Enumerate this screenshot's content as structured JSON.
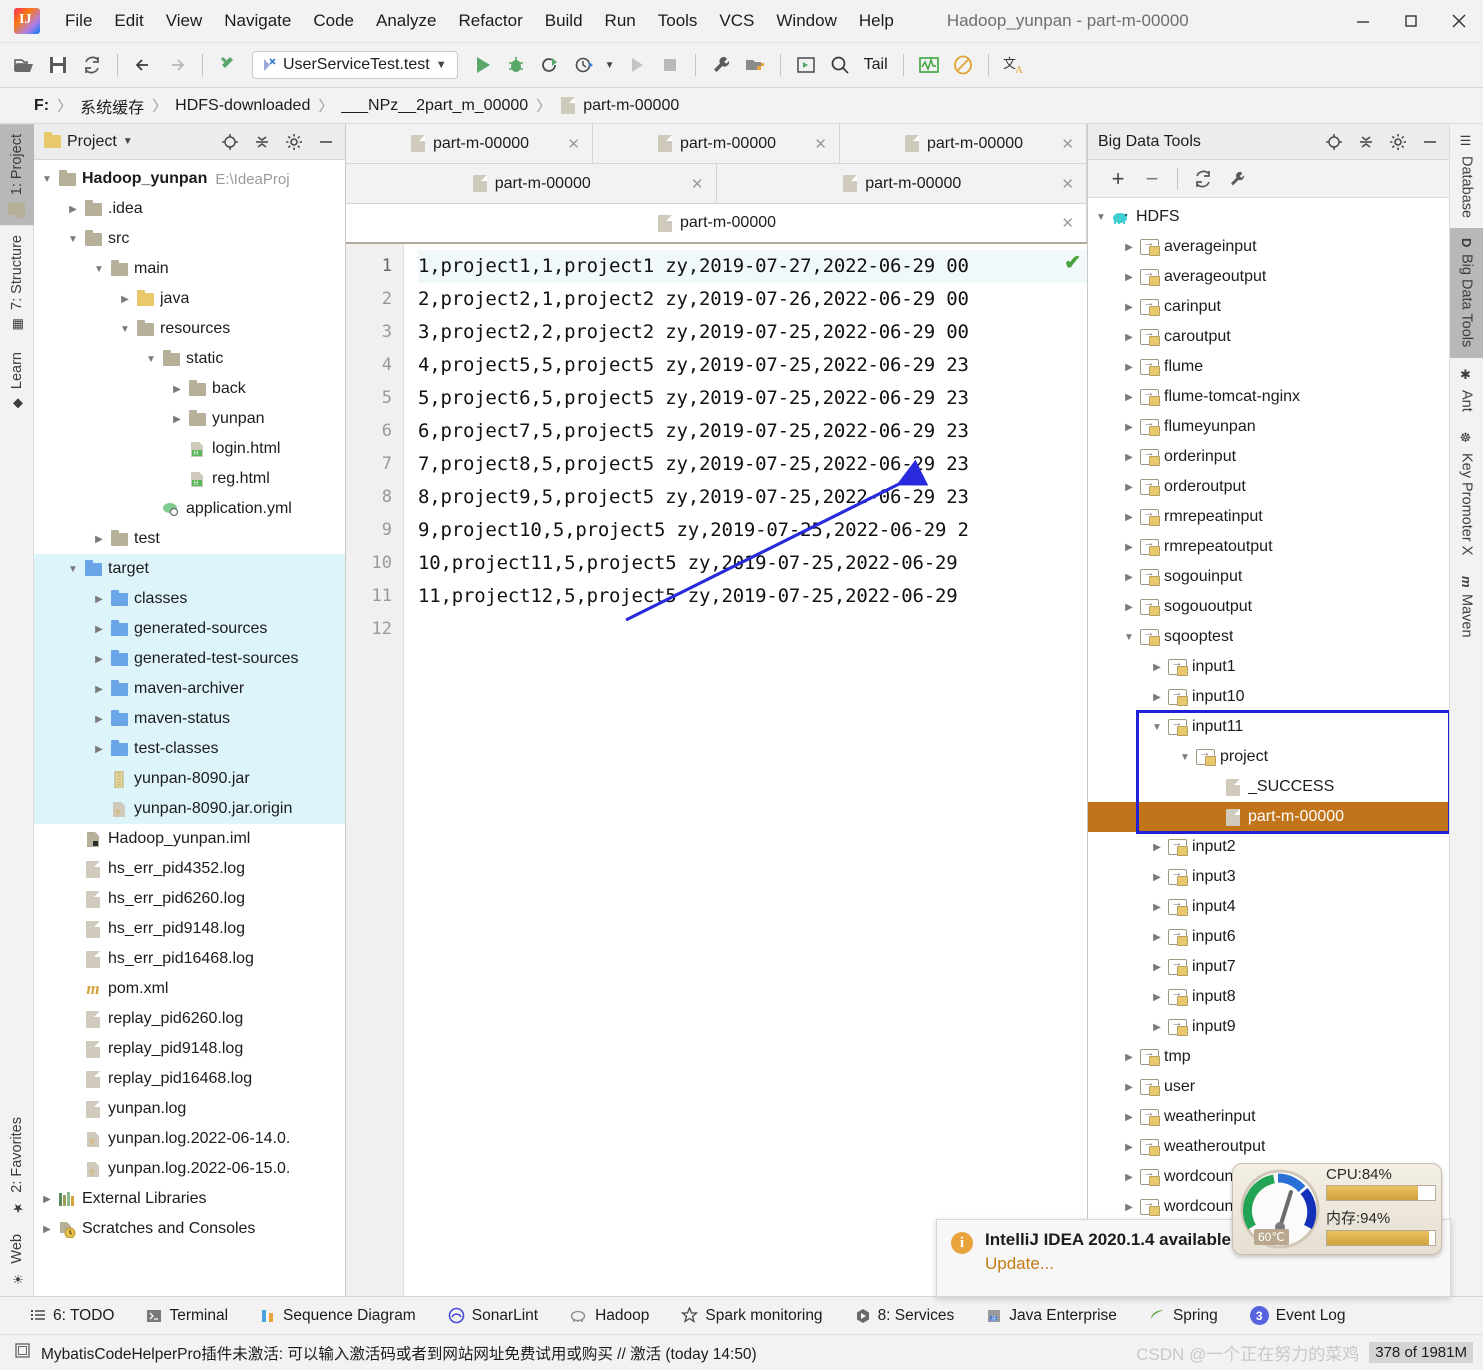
{
  "window": {
    "title": "Hadoop_yunpan - part-m-00000",
    "minimize": "—",
    "maximize": "□",
    "close": "✕"
  },
  "menubar": {
    "items": [
      {
        "label": "File"
      },
      {
        "label": "Edit"
      },
      {
        "label": "View"
      },
      {
        "label": "Navigate"
      },
      {
        "label": "Code"
      },
      {
        "label": "Analyze"
      },
      {
        "label": "Refactor"
      },
      {
        "label": "Build"
      },
      {
        "label": "Run"
      },
      {
        "label": "Tools"
      },
      {
        "label": "VCS"
      },
      {
        "label": "Window"
      },
      {
        "label": "Help"
      }
    ]
  },
  "toolbar": {
    "open_icon": "open-folder-icon",
    "save_icon": "save-icon",
    "sync_icon": "refresh-icon",
    "back_icon": "back-arrow-icon",
    "forward_icon": "forward-arrow-icon",
    "build_icon": "hammer-icon",
    "run_config": "UserServiceTest.test",
    "run_icon": "run-icon",
    "debug_icon": "debug-icon",
    "run_coverage_icon": "run-with-coverage-icon",
    "profile_icon": "profiler-icon",
    "stop_icon": "stop-icon",
    "settings_icon": "wrench-icon",
    "project_structure_icon": "project-structure-icon",
    "terminal_icon": "run-anything-icon",
    "search_icon": "search-everywhere-icon",
    "tail_label": "Tail",
    "monitor_icon": "monitor-icon",
    "no_icon": "suppress-icon",
    "translate_icon": "translate-icon"
  },
  "breadcrumb": {
    "drive": "F:",
    "items": [
      "系统缓存",
      "HDFS-downloaded",
      "___NPz__2part_m_00000",
      "part-m-00000"
    ],
    "separator": "〉"
  },
  "left_stripe": {
    "tabs": [
      {
        "label": "1: Project",
        "icon": "project-folder-icon",
        "active": true
      },
      {
        "label": "7: Structure",
        "icon": "structure-icon",
        "active": false
      },
      {
        "label": "Learn",
        "icon": "learn-icon",
        "active": false
      }
    ],
    "bottom_tabs": [
      {
        "label": "2: Favorites",
        "icon": "star-icon"
      },
      {
        "label": "Web",
        "icon": "web-icon"
      }
    ]
  },
  "right_stripe": {
    "tabs": [
      {
        "label": "Database",
        "icon": "database-icon",
        "active": false
      },
      {
        "label": "Big Data Tools",
        "icon": "big-data-tools-icon",
        "active": true
      },
      {
        "label": "Ant",
        "icon": "ant-icon",
        "active": false
      },
      {
        "label": "Key Promoter X",
        "icon": "key-promoter-icon",
        "active": false
      },
      {
        "label": "Maven",
        "icon": "maven-icon",
        "active": false
      }
    ]
  },
  "project_panel": {
    "title": "Project",
    "dropdown_icon": "chevron-down-icon",
    "locate_icon": "locate-icon",
    "collapse_icon": "collapse-all-icon",
    "settings_icon": "gear-icon",
    "hide_icon": "hide-icon",
    "tree": [
      {
        "label": "Hadoop_yunpan",
        "path": "E:\\IdeaProj",
        "depth": 0,
        "arrow": "down",
        "icon": "module-folder-icon",
        "bold": true,
        "hl": false
      },
      {
        "label": ".idea",
        "depth": 1,
        "arrow": "right",
        "icon": "folder-icon",
        "hl": false
      },
      {
        "label": "src",
        "depth": 1,
        "arrow": "down",
        "icon": "folder-icon",
        "hl": false
      },
      {
        "label": "main",
        "depth": 2,
        "arrow": "down",
        "icon": "folder-icon",
        "hl": false
      },
      {
        "label": "java",
        "depth": 3,
        "arrow": "right",
        "icon": "source-folder-icon",
        "hl": false
      },
      {
        "label": "resources",
        "depth": 3,
        "arrow": "down",
        "icon": "resources-folder-icon",
        "hl": false
      },
      {
        "label": "static",
        "depth": 4,
        "arrow": "down",
        "icon": "folder-icon",
        "hl": false
      },
      {
        "label": "back",
        "depth": 5,
        "arrow": "right",
        "icon": "folder-icon",
        "hl": false
      },
      {
        "label": "yunpan",
        "depth": 5,
        "arrow": "right",
        "icon": "folder-icon",
        "hl": false
      },
      {
        "label": "login.html",
        "depth": 5,
        "arrow": "none",
        "icon": "html-file-icon",
        "hl": false
      },
      {
        "label": "reg.html",
        "depth": 5,
        "arrow": "none",
        "icon": "html-file-icon",
        "hl": false
      },
      {
        "label": "application.yml",
        "depth": 4,
        "arrow": "none",
        "icon": "yml-file-icon",
        "hl": false
      },
      {
        "label": "test",
        "depth": 2,
        "arrow": "right",
        "icon": "folder-icon",
        "hl": false
      },
      {
        "label": "target",
        "depth": 1,
        "arrow": "down",
        "icon": "folder-blue-icon",
        "hl": true
      },
      {
        "label": "classes",
        "depth": 2,
        "arrow": "right",
        "icon": "folder-blue-icon",
        "hl": true
      },
      {
        "label": "generated-sources",
        "depth": 2,
        "arrow": "right",
        "icon": "folder-blue-icon",
        "hl": true
      },
      {
        "label": "generated-test-sources",
        "depth": 2,
        "arrow": "right",
        "icon": "folder-blue-icon",
        "hl": true
      },
      {
        "label": "maven-archiver",
        "depth": 2,
        "arrow": "right",
        "icon": "folder-blue-icon",
        "hl": true
      },
      {
        "label": "maven-status",
        "depth": 2,
        "arrow": "right",
        "icon": "folder-blue-icon",
        "hl": true
      },
      {
        "label": "test-classes",
        "depth": 2,
        "arrow": "right",
        "icon": "folder-blue-icon",
        "hl": true
      },
      {
        "label": "yunpan-8090.jar",
        "depth": 2,
        "arrow": "none",
        "icon": "jar-file-icon",
        "hl": true
      },
      {
        "label": "yunpan-8090.jar.origin",
        "depth": 2,
        "arrow": "none",
        "icon": "unknown-file-icon",
        "hl": true
      },
      {
        "label": "Hadoop_yunpan.iml",
        "depth": 1,
        "arrow": "none",
        "icon": "iml-file-icon",
        "hl": false
      },
      {
        "label": "hs_err_pid4352.log",
        "depth": 1,
        "arrow": "none",
        "icon": "log-file-icon",
        "hl": false
      },
      {
        "label": "hs_err_pid6260.log",
        "depth": 1,
        "arrow": "none",
        "icon": "log-file-icon",
        "hl": false
      },
      {
        "label": "hs_err_pid9148.log",
        "depth": 1,
        "arrow": "none",
        "icon": "log-file-icon",
        "hl": false
      },
      {
        "label": "hs_err_pid16468.log",
        "depth": 1,
        "arrow": "none",
        "icon": "log-file-icon",
        "hl": false
      },
      {
        "label": "pom.xml",
        "depth": 1,
        "arrow": "none",
        "icon": "maven-pom-icon",
        "hl": false
      },
      {
        "label": "replay_pid6260.log",
        "depth": 1,
        "arrow": "none",
        "icon": "log-file-icon",
        "hl": false
      },
      {
        "label": "replay_pid9148.log",
        "depth": 1,
        "arrow": "none",
        "icon": "log-file-icon",
        "hl": false
      },
      {
        "label": "replay_pid16468.log",
        "depth": 1,
        "arrow": "none",
        "icon": "log-file-icon",
        "hl": false
      },
      {
        "label": "yunpan.log",
        "depth": 1,
        "arrow": "none",
        "icon": "log-file-icon",
        "hl": false
      },
      {
        "label": "yunpan.log.2022-06-14.0.",
        "depth": 1,
        "arrow": "none",
        "icon": "unknown-file-icon",
        "hl": false
      },
      {
        "label": "yunpan.log.2022-06-15.0.",
        "depth": 1,
        "arrow": "none",
        "icon": "unknown-file-icon",
        "hl": false
      },
      {
        "label": "External Libraries",
        "depth": 0,
        "arrow": "right",
        "icon": "libraries-icon",
        "hl": false
      },
      {
        "label": "Scratches and Consoles",
        "depth": 0,
        "arrow": "right",
        "icon": "scratches-icon",
        "hl": false
      }
    ]
  },
  "editor": {
    "tab_rows": [
      [
        {
          "label": "part-m-00000",
          "close": "✕",
          "selected": false
        },
        {
          "label": "part-m-00000",
          "close": "✕",
          "selected": false
        },
        {
          "label": "part-m-00000",
          "close": "✕",
          "selected": false
        }
      ],
      [
        {
          "label": "part-m-00000",
          "close": "✕",
          "selected": false
        },
        {
          "label": "part-m-00000",
          "close": "✕",
          "selected": false
        }
      ],
      [
        {
          "label": "part-m-00000",
          "close": "✕",
          "selected": true
        }
      ]
    ],
    "line_numbers": [
      "1",
      "2",
      "3",
      "4",
      "5",
      "6",
      "7",
      "8",
      "9",
      "10",
      "11",
      "12"
    ],
    "lines": [
      "1,project1,1,project1 zy,2019-07-27,2022-06-29 00",
      "2,project2,1,project2 zy,2019-07-26,2022-06-29 00",
      "3,project2,2,project2 zy,2019-07-25,2022-06-29 00",
      "4,project5,5,project5 zy,2019-07-25,2022-06-29 23",
      "5,project6,5,project5 zy,2019-07-25,2022-06-29 23",
      "6,project7,5,project5 zy,2019-07-25,2022-06-29 23",
      "7,project8,5,project5 zy,2019-07-25,2022-06-29 23",
      "8,project9,5,project5 zy,2019-07-25,2022-06-29 23",
      "9,project10,5,project5 zy,2019-07-25,2022-06-29 2",
      "10,project11,5,project5 zy,2019-07-25,2022-06-29",
      "11,project12,5,project5 zy,2019-07-25,2022-06-29",
      ""
    ],
    "inspection_ok": "✔"
  },
  "bdt_panel": {
    "title": "Big Data Tools",
    "locate_icon": "locate-icon",
    "collapse_icon": "collapse-all-icon",
    "settings_icon": "gear-icon",
    "hide_icon": "hide-icon",
    "toolbar": {
      "add": "+",
      "remove": "−",
      "refresh_icon": "refresh-icon",
      "config_icon": "wrench-icon"
    },
    "tree": [
      {
        "label": "HDFS",
        "depth": 0,
        "arrow": "down",
        "icon": "hadoop-icon",
        "sel": false
      },
      {
        "label": "averageinput",
        "depth": 1,
        "arrow": "right",
        "icon": "hdfs-folder-icon",
        "sel": false
      },
      {
        "label": "averageoutput",
        "depth": 1,
        "arrow": "right",
        "icon": "hdfs-folder-icon",
        "sel": false
      },
      {
        "label": "carinput",
        "depth": 1,
        "arrow": "right",
        "icon": "hdfs-folder-icon",
        "sel": false
      },
      {
        "label": "caroutput",
        "depth": 1,
        "arrow": "right",
        "icon": "hdfs-folder-icon",
        "sel": false
      },
      {
        "label": "flume",
        "depth": 1,
        "arrow": "right",
        "icon": "hdfs-folder-icon",
        "sel": false
      },
      {
        "label": "flume-tomcat-nginx",
        "depth": 1,
        "arrow": "right",
        "icon": "hdfs-folder-icon",
        "sel": false
      },
      {
        "label": "flumeyunpan",
        "depth": 1,
        "arrow": "right",
        "icon": "hdfs-folder-icon",
        "sel": false
      },
      {
        "label": "orderinput",
        "depth": 1,
        "arrow": "right",
        "icon": "hdfs-folder-icon",
        "sel": false
      },
      {
        "label": "orderoutput",
        "depth": 1,
        "arrow": "right",
        "icon": "hdfs-folder-icon",
        "sel": false
      },
      {
        "label": "rmrepeatinput",
        "depth": 1,
        "arrow": "right",
        "icon": "hdfs-folder-icon",
        "sel": false
      },
      {
        "label": "rmrepeatoutput",
        "depth": 1,
        "arrow": "right",
        "icon": "hdfs-folder-icon",
        "sel": false
      },
      {
        "label": "sogouinput",
        "depth": 1,
        "arrow": "right",
        "icon": "hdfs-folder-icon",
        "sel": false
      },
      {
        "label": "sogououtput",
        "depth": 1,
        "arrow": "right",
        "icon": "hdfs-folder-icon",
        "sel": false
      },
      {
        "label": "sqooptest",
        "depth": 1,
        "arrow": "down",
        "icon": "hdfs-folder-icon",
        "sel": false
      },
      {
        "label": "input1",
        "depth": 2,
        "arrow": "right",
        "icon": "hdfs-folder-icon",
        "sel": false
      },
      {
        "label": "input10",
        "depth": 2,
        "arrow": "right",
        "icon": "hdfs-folder-icon",
        "sel": false
      },
      {
        "label": "input11",
        "depth": 2,
        "arrow": "down",
        "icon": "hdfs-folder-icon",
        "sel": false
      },
      {
        "label": "project",
        "depth": 3,
        "arrow": "down",
        "icon": "hdfs-folder-icon",
        "sel": false
      },
      {
        "label": "_SUCCESS",
        "depth": 4,
        "arrow": "none",
        "icon": "hdfs-file-icon",
        "sel": false
      },
      {
        "label": "part-m-00000",
        "depth": 4,
        "arrow": "none",
        "icon": "hdfs-file-icon",
        "sel": true
      },
      {
        "label": "input2",
        "depth": 2,
        "arrow": "right",
        "icon": "hdfs-folder-icon",
        "sel": false
      },
      {
        "label": "input3",
        "depth": 2,
        "arrow": "right",
        "icon": "hdfs-folder-icon",
        "sel": false
      },
      {
        "label": "input4",
        "depth": 2,
        "arrow": "right",
        "icon": "hdfs-folder-icon",
        "sel": false
      },
      {
        "label": "input6",
        "depth": 2,
        "arrow": "right",
        "icon": "hdfs-folder-icon",
        "sel": false
      },
      {
        "label": "input7",
        "depth": 2,
        "arrow": "right",
        "icon": "hdfs-folder-icon",
        "sel": false
      },
      {
        "label": "input8",
        "depth": 2,
        "arrow": "right",
        "icon": "hdfs-folder-icon",
        "sel": false
      },
      {
        "label": "input9",
        "depth": 2,
        "arrow": "right",
        "icon": "hdfs-folder-icon",
        "sel": false
      },
      {
        "label": "tmp",
        "depth": 1,
        "arrow": "right",
        "icon": "hdfs-folder-icon",
        "sel": false
      },
      {
        "label": "user",
        "depth": 1,
        "arrow": "right",
        "icon": "hdfs-folder-icon",
        "sel": false
      },
      {
        "label": "weatherinput",
        "depth": 1,
        "arrow": "right",
        "icon": "hdfs-folder-icon",
        "sel": false
      },
      {
        "label": "weatheroutput",
        "depth": 1,
        "arrow": "right",
        "icon": "hdfs-folder-icon",
        "sel": false
      },
      {
        "label": "wordcountinput",
        "depth": 1,
        "arrow": "right",
        "icon": "hdfs-folder-icon",
        "sel": false
      },
      {
        "label": "wordcountoutput",
        "depth": 1,
        "arrow": "right",
        "icon": "hdfs-folder-icon",
        "sel": false
      }
    ]
  },
  "notification": {
    "icon": "info-icon",
    "title": "IntelliJ IDEA 2020.1.4 available",
    "action": "Update..."
  },
  "cpu_widget": {
    "cpu_label": "CPU:84%",
    "cpu_percent": 84,
    "mem_label": "内存:94%",
    "mem_percent": 94,
    "temp": "60℃"
  },
  "bottom_bar": {
    "items": [
      {
        "label": "6: TODO",
        "icon": "todo-icon"
      },
      {
        "label": "Terminal",
        "icon": "terminal-icon"
      },
      {
        "label": "Sequence Diagram",
        "icon": "sequence-diagram-icon"
      },
      {
        "label": "SonarLint",
        "icon": "sonarlint-icon"
      },
      {
        "label": "Hadoop",
        "icon": "hadoop-icon"
      },
      {
        "label": "Spark monitoring",
        "icon": "star-outline-icon"
      },
      {
        "label": "8: Services",
        "icon": "services-icon"
      },
      {
        "label": "Java Enterprise",
        "icon": "java-enterprise-icon"
      },
      {
        "label": "Spring",
        "icon": "spring-leaf-icon"
      },
      {
        "label": "Event Log",
        "icon": "event-log-icon",
        "badge": "3"
      }
    ]
  },
  "status_bar": {
    "icon": "status-note-icon",
    "message": "MybatisCodeHelperPro插件未激活: 可以输入激活码或者到网站网址免费试用或购买 // 激活 (today 14:50)",
    "watermark": "CSDN @一个正在努力的菜鸡",
    "memory": "378 of 1981M"
  }
}
